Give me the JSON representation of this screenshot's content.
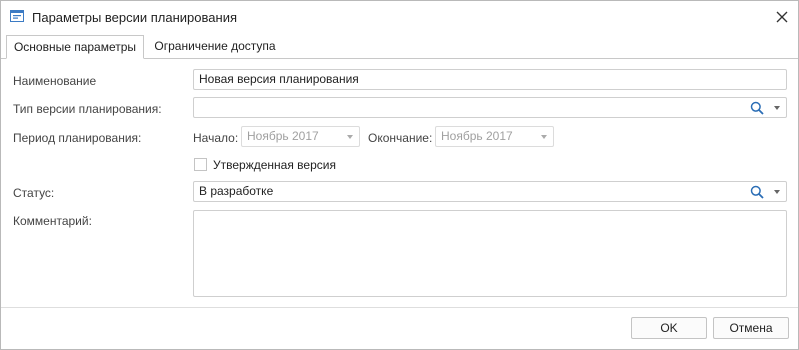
{
  "window": {
    "title": "Параметры версии планирования"
  },
  "tabs": [
    {
      "label": "Основные параметры",
      "active": true
    },
    {
      "label": "Ограничение доступа",
      "active": false
    }
  ],
  "form": {
    "name_label": "Наименование",
    "name_value": "Новая версия планирования",
    "version_type_label": "Тип версии планирования:",
    "version_type_value": "",
    "period_label": "Период планирования:",
    "start_label": "Начало:",
    "start_value": "Ноябрь 2017",
    "end_label": "Окончание:",
    "end_value": "Ноябрь 2017",
    "approved_label": "Утвержденная версия",
    "approved_checked": false,
    "status_label": "Статус:",
    "status_value": "В разработке",
    "comment_label": "Комментарий:",
    "comment_value": ""
  },
  "buttons": {
    "ok": "OK",
    "cancel": "Отмена"
  },
  "icons": {
    "title": "window-form-icon",
    "close": "close-icon",
    "search": "search-icon",
    "dropdown": "chevron-down-icon"
  },
  "colors": {
    "search_icon": "#2a6db5",
    "border": "#cfcfcf",
    "disabled_text": "#a0a0a0"
  }
}
